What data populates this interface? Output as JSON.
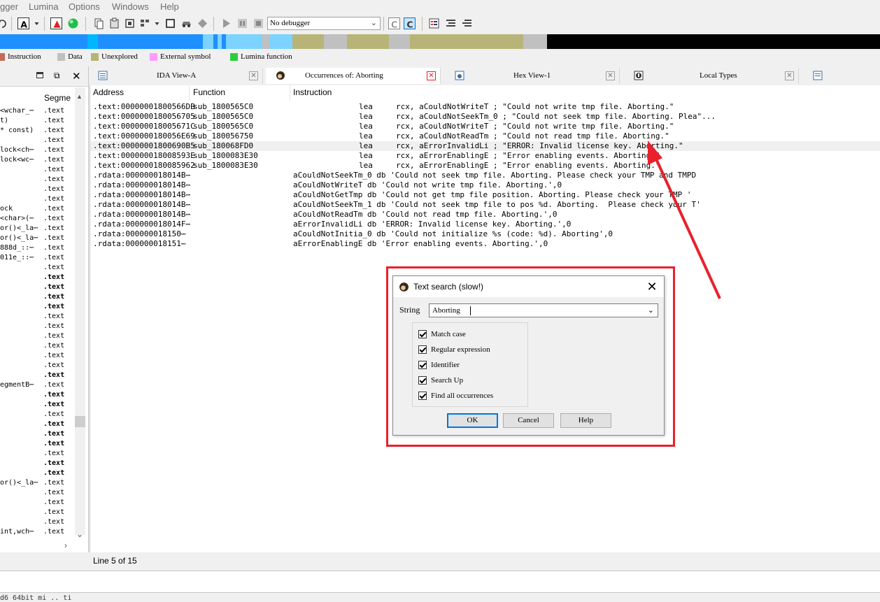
{
  "menu": {
    "items": [
      "gger",
      "Lumina",
      "Options",
      "Windows",
      "Help"
    ]
  },
  "toolbar": {
    "debugger_select": "No debugger",
    "icons": [
      "undo-icon",
      "text-mode-icon",
      "breakpoint-icon",
      "green-circle-icon",
      "copy-icon",
      "paste-icon",
      "module-icon",
      "grid-icon",
      "square-icon",
      "car-icon",
      "diamond-icon",
      "play-icon",
      "pause-icon",
      "stop-icon",
      "c-icon",
      "c-active-icon",
      "list-icon",
      "list-indent-icon",
      "list-outdent-icon"
    ]
  },
  "legend": {
    "items": [
      {
        "label": "Instruction",
        "color": "#c56a5a"
      },
      {
        "label": "Data",
        "color": "#c0c0c0"
      },
      {
        "label": "Unexplored",
        "color": "#b8b478"
      },
      {
        "label": "External symbol",
        "color": "#ff9cff"
      },
      {
        "label": "Lumina function",
        "color": "#2ecc40"
      }
    ]
  },
  "left_panel": {
    "column_header": "Segme",
    "rows": [
      {
        "name": "<wchar_⋯",
        "seg": ".text",
        "bold": false
      },
      {
        "name": "t)",
        "seg": ".text",
        "bold": false
      },
      {
        "name": "* const)",
        "seg": ".text",
        "bold": false
      },
      {
        "name": "",
        "seg": ".text",
        "bold": false
      },
      {
        "name": "lock<ch⋯",
        "seg": ".text",
        "bold": false
      },
      {
        "name": "lock<wc⋯",
        "seg": ".text",
        "bold": false
      },
      {
        "name": "",
        "seg": ".text",
        "bold": false
      },
      {
        "name": "",
        "seg": ".text",
        "bold": false
      },
      {
        "name": "",
        "seg": ".text",
        "bold": false
      },
      {
        "name": "",
        "seg": ".text",
        "bold": false
      },
      {
        "name": "ock",
        "seg": ".text",
        "bold": false
      },
      {
        "name": "<char>(⋯",
        "seg": ".text",
        "bold": false
      },
      {
        "name": "or()<_la⋯",
        "seg": ".text",
        "bold": false
      },
      {
        "name": "or()<_la⋯",
        "seg": ".text",
        "bold": false
      },
      {
        "name": "888d_::⋯",
        "seg": ".text",
        "bold": false
      },
      {
        "name": "011e_::⋯",
        "seg": ".text",
        "bold": false
      },
      {
        "name": "",
        "seg": ".text",
        "bold": false
      },
      {
        "name": "",
        "seg": ".text",
        "bold": true
      },
      {
        "name": "",
        "seg": ".text",
        "bold": true
      },
      {
        "name": "",
        "seg": ".text",
        "bold": true
      },
      {
        "name": "",
        "seg": ".text",
        "bold": true
      },
      {
        "name": "",
        "seg": ".text",
        "bold": false
      },
      {
        "name": "",
        "seg": ".text",
        "bold": false
      },
      {
        "name": "",
        "seg": ".text",
        "bold": false
      },
      {
        "name": "",
        "seg": ".text",
        "bold": false
      },
      {
        "name": "",
        "seg": ".text",
        "bold": false
      },
      {
        "name": "",
        "seg": ".text",
        "bold": false
      },
      {
        "name": "",
        "seg": ".text",
        "bold": true
      },
      {
        "name": "egmentB⋯",
        "seg": ".text",
        "bold": false
      },
      {
        "name": "",
        "seg": ".text",
        "bold": true
      },
      {
        "name": "",
        "seg": ".text",
        "bold": true
      },
      {
        "name": "",
        "seg": ".text",
        "bold": false
      },
      {
        "name": "",
        "seg": ".text",
        "bold": true
      },
      {
        "name": "",
        "seg": ".text",
        "bold": true
      },
      {
        "name": "",
        "seg": ".text",
        "bold": true
      },
      {
        "name": "",
        "seg": ".text",
        "bold": false
      },
      {
        "name": "",
        "seg": ".text",
        "bold": true
      },
      {
        "name": "",
        "seg": ".text",
        "bold": true
      },
      {
        "name": "or()<_la⋯",
        "seg": ".text",
        "bold": false
      },
      {
        "name": "",
        "seg": ".text",
        "bold": false
      },
      {
        "name": "",
        "seg": ".text",
        "bold": false
      },
      {
        "name": "",
        "seg": ".text",
        "bold": false
      },
      {
        "name": "",
        "seg": ".text",
        "bold": false
      },
      {
        "name": "int,wch⋯",
        "seg": ".text",
        "bold": false
      }
    ]
  },
  "tabs": [
    {
      "label": "IDA View-A"
    },
    {
      "label": "Occurrences of: Aborting"
    },
    {
      "label": "Hex View-1"
    },
    {
      "label": "Local Types"
    }
  ],
  "list": {
    "headers": [
      "Address",
      "Function",
      "Instruction"
    ],
    "rows": [
      {
        "addr": ".text:00000001800566DB",
        "func": "sub_1800565C0",
        "instr": "lea     rcx, aCouldNotWriteT ; \"Could not write tmp file. Aborting.\"",
        "indent": true
      },
      {
        "addr": ".text:0000000180056705",
        "func": "sub_1800565C0",
        "instr": "lea     rcx, aCouldNotSeekTm_0 ; \"Could not seek tmp file. Aborting. Plea\"...",
        "indent": true
      },
      {
        "addr": ".text:000000018005671C",
        "func": "sub_1800565C0",
        "instr": "lea     rcx, aCouldNotWriteT ; \"Could not write tmp file. Aborting.\"",
        "indent": true
      },
      {
        "addr": ".text:0000000180056E69",
        "func": "sub_180056750",
        "instr": "lea     rcx, aCouldNotReadTm ; \"Could not read tmp file. Aborting.\"",
        "indent": true
      },
      {
        "addr": ".text:00000001800690B5",
        "func": "sub_180068FD0",
        "instr": "lea     rcx, aErrorInvalidLi ; \"ERROR: Invalid license key. Aborting.\"",
        "indent": true,
        "selected": true
      },
      {
        "addr": ".text:000000018008593E",
        "func": "sub_1800083E30",
        "instr": "lea     rcx, aErrorEnablingE ; \"Error enabling events. Aborting.\"",
        "indent": true
      },
      {
        "addr": ".text:0000000180085962",
        "func": "sub_1800083E30",
        "instr": "lea     rcx, aErrorEnablingE ; \"Error enabling events. Aborting.\"",
        "indent": true
      },
      {
        "addr": ".rdata:000000018014B⋯",
        "func": "",
        "instr": "aCouldNotSeekTm_0 db 'Could not seek tmp file. Aborting. Please check your TMP and TMPD",
        "indent": false
      },
      {
        "addr": ".rdata:000000018014B⋯",
        "func": "",
        "instr": "aCouldNotWriteT db 'Could not write tmp file. Aborting.',0",
        "indent": false
      },
      {
        "addr": ".rdata:000000018014B⋯",
        "func": "",
        "instr": "aCouldNotGetTmp db 'Could not get tmp file position. Aborting. Please check your TMP '",
        "indent": false
      },
      {
        "addr": ".rdata:000000018014B⋯",
        "func": "",
        "instr": "aCouldNotSeekTm_1 db 'Could not seek tmp file to pos %d. Aborting.  Please check your T'",
        "indent": false
      },
      {
        "addr": ".rdata:000000018014B⋯",
        "func": "",
        "instr": "aCouldNotReadTm db 'Could not read tmp file. Aborting.',0",
        "indent": false
      },
      {
        "addr": ".rdata:000000018014F⋯",
        "func": "",
        "instr": "aErrorInvalidLi db 'ERROR: Invalid license key. Aborting.',0",
        "indent": false
      },
      {
        "addr": ".rdata:000000018150⋯",
        "func": "",
        "instr": "aCouldNotInitia_0 db 'Could not initialize %s (code: %d). Aborting',0",
        "indent": false
      },
      {
        "addr": ".rdata:000000018151⋯",
        "func": "",
        "instr": "aErrorEnablingE db 'Error enabling events. Aborting.',0",
        "indent": false
      }
    ]
  },
  "status": {
    "line": "Line 5 of 15"
  },
  "dialog": {
    "title": "Text search (slow!)",
    "string_label": "String",
    "string_value": "Aborting",
    "options": [
      {
        "label": "Match case",
        "checked": true
      },
      {
        "label": "Regular expression",
        "checked": true
      },
      {
        "label": "Identifier",
        "checked": true
      },
      {
        "label": "Search Up",
        "checked": true
      },
      {
        "label": "Find all occurrences",
        "checked": true
      }
    ],
    "buttons": {
      "ok": "OK",
      "cancel": "Cancel",
      "help": "Help"
    }
  },
  "bottom": {
    "text": "d6 64bit mi     ..  ti"
  },
  "colors": {
    "highlight": "#e8212d",
    "selection_row": "#f0f0f0"
  }
}
